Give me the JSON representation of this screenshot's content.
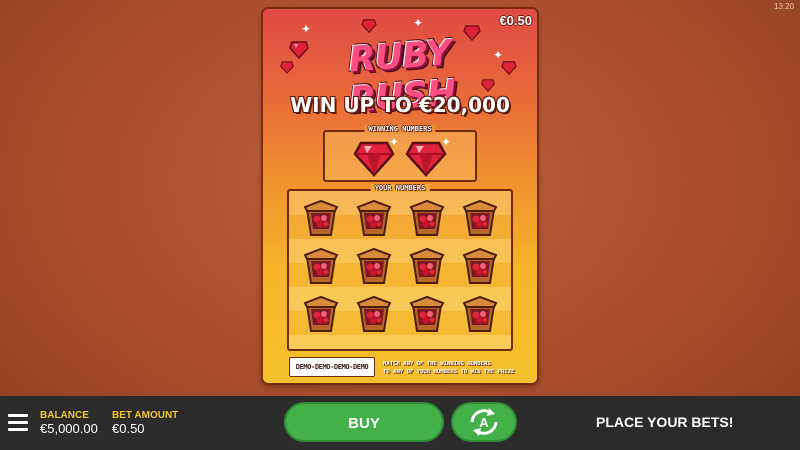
{
  "clock": "13:20",
  "card": {
    "price": "€0.50",
    "logo_text": "RUBY RUSH",
    "headline": "WIN UP TO €20,000",
    "winning_label": "WINNING NUMBERS",
    "your_label": "YOUR NUMBERS",
    "demo_badge": "DEMO-DEMO-DEMO-DEMO",
    "instruction_line1": "MATCH ANY OF THE WINNING NUMBERS",
    "instruction_line2": "TO ANY OF YOUR NUMBERS TO WIN THE PRIZE",
    "winning_symbols": [
      "ruby-icon",
      "ruby-icon"
    ],
    "your_symbols_count": 12
  },
  "bottom_bar": {
    "balance_label": "BALANCE",
    "balance_value": "€5,000.00",
    "bet_label": "BET AMOUNT",
    "bet_value": "€0.50",
    "buy_label": "BUY",
    "status": "PLACE YOUR BETS!"
  },
  "colors": {
    "card_top": "#e04a45",
    "card_bottom": "#f5c02d",
    "button_green": "#44b04a",
    "label_gold": "#f0c42a",
    "bar_bg": "#2b2b2b"
  }
}
